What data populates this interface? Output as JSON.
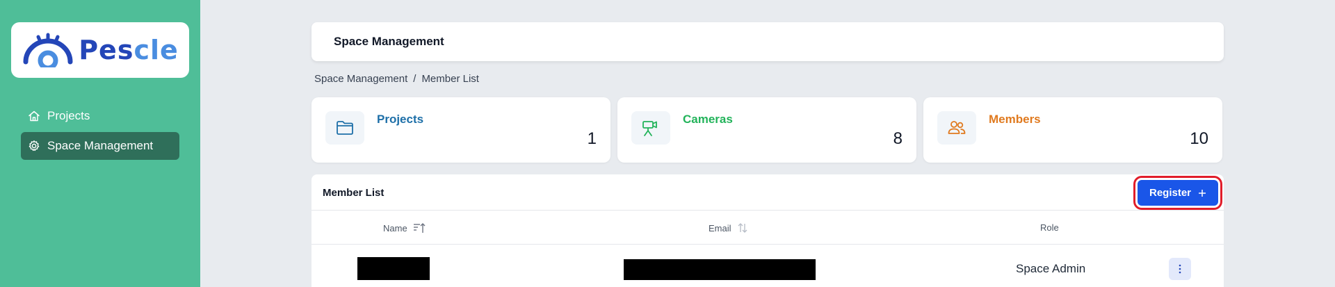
{
  "logo": {
    "text_main": "Pes",
    "text_accent": "cle",
    "colors": {
      "main": "#2446b8",
      "accent": "#4a8de0"
    }
  },
  "sidebar": {
    "background": "#4fbe98",
    "items": [
      {
        "label": "Projects",
        "icon": "home-icon",
        "active": false
      },
      {
        "label": "Space Management",
        "icon": "gear-icon",
        "active": true
      }
    ]
  },
  "header": {
    "title": "Space Management"
  },
  "breadcrumb": {
    "items": [
      "Space Management",
      "Member List"
    ],
    "separator": "/"
  },
  "stats": [
    {
      "label": "Projects",
      "value": "1",
      "icon": "folder-icon",
      "color": "#1d6fa8"
    },
    {
      "label": "Cameras",
      "value": "8",
      "icon": "camera-icon",
      "color": "#22b35a"
    },
    {
      "label": "Members",
      "value": "10",
      "icon": "users-icon",
      "color": "#e07a1f"
    }
  ],
  "member_list": {
    "title": "Member List",
    "register_label": "Register",
    "register_icon": "plus-icon",
    "columns": [
      {
        "label": "Name",
        "sort_icon": "sort-ascending-icon"
      },
      {
        "label": "Email",
        "sort_icon": "sort-icon"
      },
      {
        "label": "Role"
      }
    ],
    "rows": [
      {
        "role": "Space Admin"
      }
    ]
  }
}
